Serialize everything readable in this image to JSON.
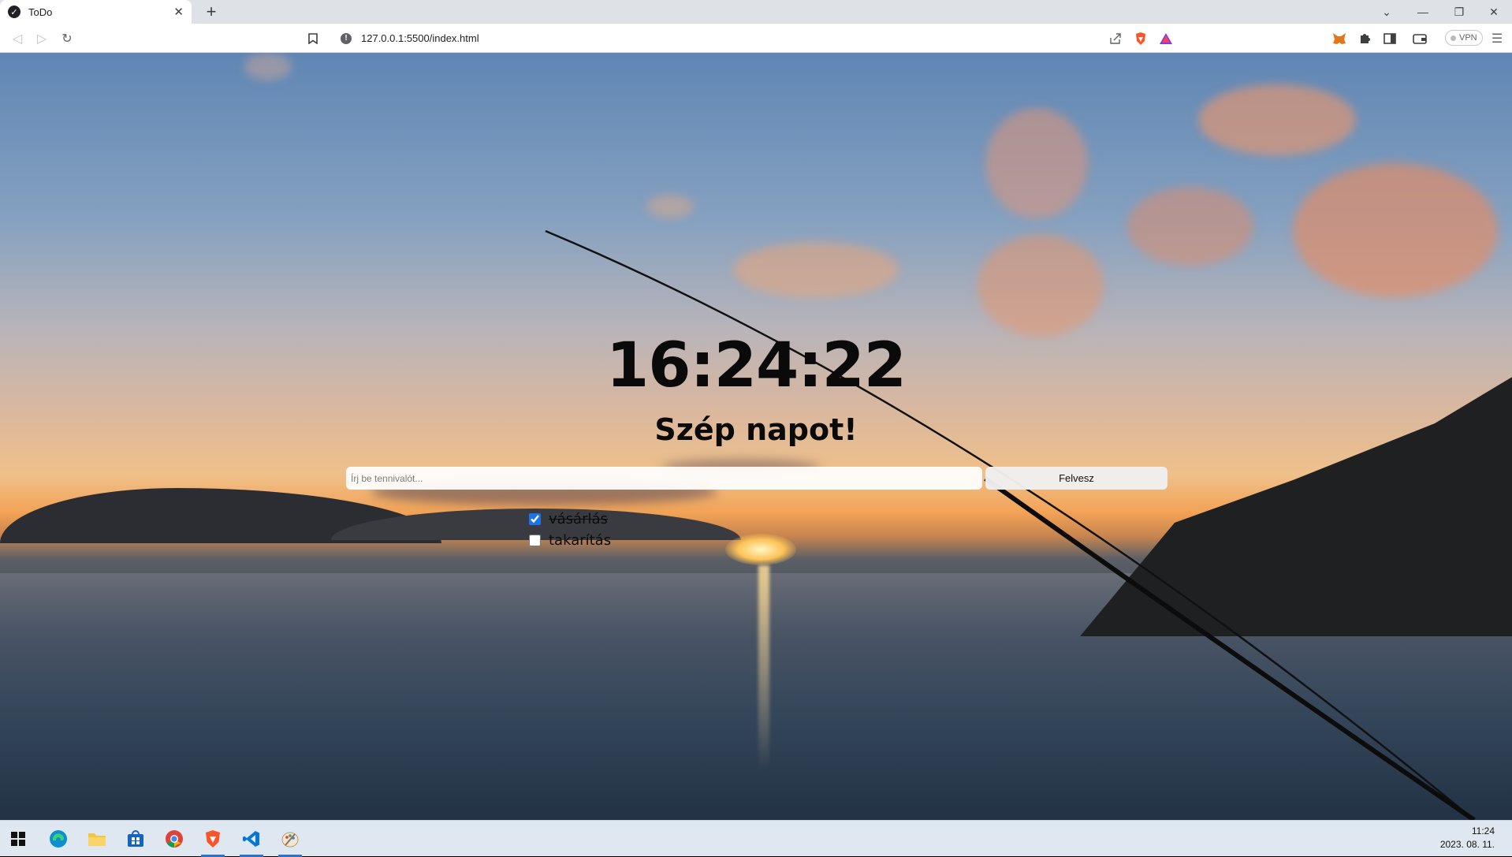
{
  "browser": {
    "tab_title": "ToDo",
    "url": "127.0.0.1:5500/index.html",
    "vpn_label": "VPN"
  },
  "app": {
    "clock": "16:24:22",
    "greeting": "Szép napot!",
    "input_placeholder": "Írj be tennivalót...",
    "add_button_label": "Felvesz",
    "todos": [
      {
        "label": "vásárlás",
        "done": true
      },
      {
        "label": "takarítás",
        "done": false
      }
    ]
  },
  "taskbar": {
    "time": "11:24",
    "date": "2023. 08. 11."
  },
  "colors": {
    "accent": "#1a73e8",
    "taskbar": "#dfe8f0",
    "brave_orange": "#fb542b",
    "vscode_blue": "#0078d4"
  }
}
